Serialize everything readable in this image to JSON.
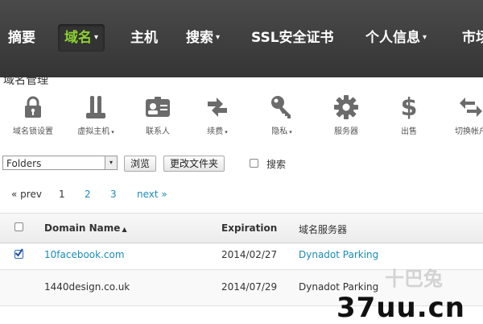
{
  "nav": {
    "items": [
      {
        "label": "摘要",
        "caret": false
      },
      {
        "label": "域名",
        "caret": true,
        "active": true
      },
      {
        "label": "主机",
        "caret": false
      },
      {
        "label": "搜索",
        "caret": true
      },
      {
        "label": "SSL安全证书",
        "caret": false
      },
      {
        "label": "个人信息",
        "caret": true
      },
      {
        "label": "市场",
        "caret": false
      }
    ],
    "caret_glyph": "▾"
  },
  "page_title": "域名管理",
  "toolbar": [
    {
      "label": "域名锁设置",
      "icon": "lock-icon"
    },
    {
      "label": "虚拟主机",
      "icon": "server-icon",
      "caret": true
    },
    {
      "label": "联系人",
      "icon": "contact-card-icon"
    },
    {
      "label": "续费",
      "icon": "renew-icon",
      "caret": true
    },
    {
      "label": "隐私",
      "icon": "key-icon",
      "caret": true
    },
    {
      "label": "服务器",
      "icon": "gear-icon"
    },
    {
      "label": "出售",
      "icon": "dollar-icon"
    },
    {
      "label": "切换帐户",
      "icon": "swap-arrows-icon"
    }
  ],
  "folders": {
    "selected": "Folders",
    "browse_button": "浏览",
    "change_folder_button": "更改文件夹",
    "search_label": "搜索"
  },
  "pagination": {
    "prev": "« prev",
    "pages": [
      "1",
      "2",
      "3"
    ],
    "current": "1",
    "next": "next »"
  },
  "table": {
    "columns": {
      "domain": "Domain Name",
      "sort_glyph": "▲",
      "expiration": "Expiration",
      "nameserver": "域名服务器"
    },
    "rows": [
      {
        "domain": "10facebook.com",
        "expiration": "2014/02/27",
        "nameserver": "Dynadot Parking",
        "checked": true
      },
      {
        "domain": "1440design.co.uk",
        "expiration": "2014/07/29",
        "nameserver": "Dynadot Parking",
        "checked": false
      }
    ]
  },
  "watermark": {
    "logo": "37uu.cn",
    "faint": "十巴兔"
  },
  "colors": {
    "nav_bg": "#3d3d3d",
    "nav_active_text": "#8bd130",
    "link": "#1a8bb9",
    "icon_gray": "#6b6b6b"
  }
}
